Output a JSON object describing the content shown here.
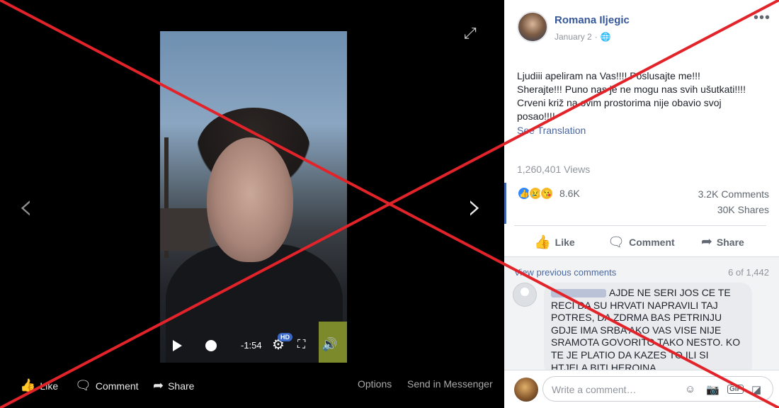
{
  "theater": {
    "time_remaining": "-1:54",
    "hd_label": "HD",
    "actions": {
      "like": "Like",
      "comment": "Comment",
      "share": "Share",
      "options": "Options",
      "send_messenger": "Send in Messenger"
    }
  },
  "post": {
    "author": "Romana Iljegic",
    "date": "January 2",
    "separator": "·",
    "text_lines": [
      "Ljudiii apeliram na Vas!!!! Poslusajte me!!!",
      "Sherajte!!! Puno nas je ne mogu nas svih ušutkati!!!!",
      "Crveni križ na ovim prostorima nije obavio svoj",
      "posao!!!!"
    ],
    "see_translation": "See Translation",
    "views": "1,260,401 Views",
    "reaction_count": "8.6K",
    "comments_count": "3.2K Comments",
    "shares_count": "30K Shares",
    "actions": {
      "like": "Like",
      "comment": "Comment",
      "share": "Share"
    }
  },
  "comments": {
    "view_previous": "View previous comments",
    "page_indicator": "6 of 1,442",
    "first_comment_text": "AJDE NE SERI JOS CE TE RECI DA SU HRVATI NAPRAVILI TAJ POTRES, DA ZDRMA BAS PETRINJU GDJE IMA SRBA AKO VAS VISE NIJE SRAMOTA GOVORITO TAKO NESTO. KO TE JE PLATIO DA KAZES TO ILI SI HTJELA BITI HEROINA",
    "composer_placeholder": "Write a comment…"
  },
  "icons": {
    "expand": "expand-icon",
    "prev": "chevron-left-icon",
    "next": "chevron-right-icon",
    "globe": "globe-icon",
    "more": "more-icon"
  },
  "colors": {
    "link_blue": "#365899",
    "facebook_blue": "#4267b2",
    "overlay_red": "#e2232a"
  }
}
